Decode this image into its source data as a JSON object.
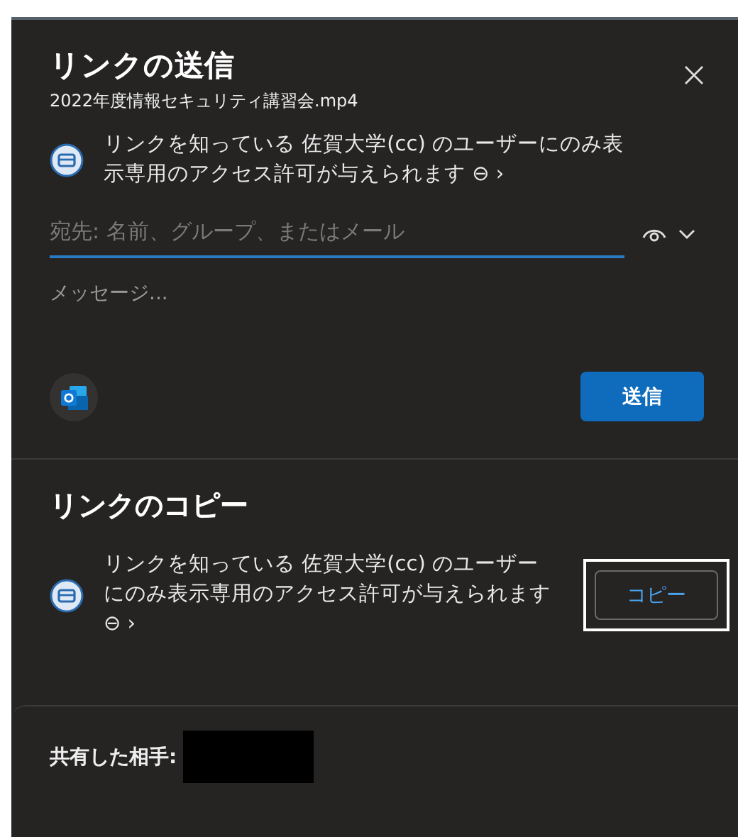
{
  "send_section": {
    "title": "リンクの送信",
    "file_name": "2022年度情報セキュリティ講習会.mp4",
    "access_note": "リンクを知っている 佐賀大学(cc) のユーザーにのみ表示専用のアクセス許可が与えられます ⊖ ›",
    "recipient_field": {
      "placeholder": "宛先: 名前、グループ、またはメール"
    },
    "message_field": {
      "placeholder": "メッセージ..."
    },
    "send_button": "送信"
  },
  "copy_section": {
    "title": "リンクのコピー",
    "access_note": "リンクを知っている 佐賀大学(cc) のユーザーにのみ表示専用のアクセス許可が与えられます ⊖ ›",
    "copy_button": {
      "label": "コピー",
      "focused": true
    }
  },
  "shared_with": {
    "label": "共有した相手:"
  }
}
